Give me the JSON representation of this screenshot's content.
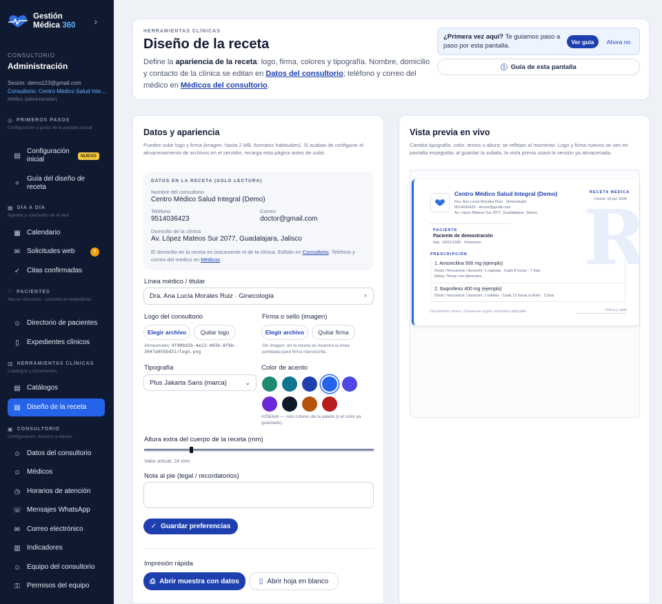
{
  "sidebar": {
    "brand_line1": "Gestión",
    "brand_line2a": "Médica",
    "brand_line2b": "360",
    "org_label": "CONSULTORIO",
    "org_name": "Administración",
    "session_label": "Sesión: demo123@gmail.com",
    "session_clinic": "Consultorio: Centro Médico Salud Integral",
    "session_role": "Médico (administrador)",
    "sections": [
      {
        "title": "PRIMEROS PASOS",
        "subtitle": "Configuración y guías de la pantalla actual"
      },
      {
        "title": "DÍA A DÍA",
        "subtitle": "Agenda y solicitudes de la web"
      },
      {
        "title": "PACIENTES",
        "subtitle": "Alta en directorio · consulta en expediente"
      },
      {
        "title": "HERRAMIENTAS CLÍNICAS",
        "subtitle": "Catálogos y documentos"
      },
      {
        "title": "CONSULTORIO",
        "subtitle": "Configuración, horarios y equipo"
      }
    ],
    "items": [
      {
        "label": "Configuración inicial",
        "badge": "NUEVO"
      },
      {
        "label": "Guía del diseño de receta"
      },
      {
        "label": "Calendario"
      },
      {
        "label": "Solicitudes web",
        "count": "7"
      },
      {
        "label": "Citas confirmadas"
      },
      {
        "label": "Directorio de pacientes"
      },
      {
        "label": "Expedientes clínicos"
      },
      {
        "label": "Catálogos"
      },
      {
        "label": "Diseño de la receta"
      },
      {
        "label": "Datos del consultorio"
      },
      {
        "label": "Médicos"
      },
      {
        "label": "Horarios de atención"
      },
      {
        "label": "Mensajes WhatsApp"
      },
      {
        "label": "Correo electrónico"
      },
      {
        "label": "Indicadores"
      },
      {
        "label": "Equipo del consultorio"
      },
      {
        "label": "Permisos del equipo"
      }
    ]
  },
  "header": {
    "eyebrow": "HERRAMIENTAS CLÍNICAS",
    "title": "Diseño de la receta",
    "lead_1": "Define la ",
    "lead_bold": "apariencia de la receta",
    "lead_2": ": logo, firma, colores y tipografía. Nombre, domicilio y contacto de la clínica se editan en ",
    "lead_link1": "Datos del consultorio",
    "lead_3": "; teléfono y correo del médico en ",
    "lead_link2": "Médicos del consultorio",
    "lead_4": ".",
    "tour_bold": "¿Primera vez aquí?",
    "tour_text": " Te guiamos paso a paso por esta pantalla.",
    "tour_primary": "Ver guía",
    "tour_secondary": "Ahora no",
    "guide_button": "Guía de esta pantalla"
  },
  "form": {
    "title": "Datos y apariencia",
    "intro": "Puedes subir logo y firma (imagen, hasta 2 MB, formatos habituales). Si acabas de configurar el almacenamiento de archivos en el servidor, recarga esta página antes de subir.",
    "readonly": {
      "eyebrow": "DATOS EN LA RECETA (SOLO LECTURA)",
      "name_label": "Nombre del consultorio",
      "name_value": "Centro Médico Salud Integral (Demo)",
      "phone_label": "Teléfono",
      "phone_value": "9514036423",
      "email_label": "Correo",
      "email_value": "doctor@gmail.com",
      "address_label": "Domicilio de la clínica",
      "address_value": "Av. López Mateos Sur 2077, Guadalajara, Jalisco",
      "note_1": "El domicilio en la receta es únicamente el de la clínica. Edítalo en ",
      "note_link1": "Consultorio",
      "note_2": ". Teléfono y correo del médico en ",
      "note_link2": "Médicos",
      "note_3": "."
    },
    "doctor_label": "Línea médico / titular",
    "doctor_value": "Dra. Ana Lucía Morales Ruiz · Ginecología",
    "logo_label": "Logo del consultorio",
    "logo_choose": "Elegir archivo",
    "logo_remove": "Quitar logo",
    "logo_stored_label": "Almacenado:",
    "logo_stored_path": "4f90bd1b-4e22-403b-8fbb-3947a955bd31/logo.png",
    "sign_label": "Firma o sello (imagen)",
    "sign_choose": "Elegir archivo",
    "sign_remove": "Quitar firma",
    "sign_note": "Sin imagen: en la receta se muestra la línea punteada para firma manuscrita.",
    "font_label": "Tipografía",
    "font_value": "Plus Jakarta Sans (marca)",
    "color_label": "Color de acento",
    "colors": [
      "#1f8a70",
      "#0e7490",
      "#1e40af",
      "#2563eb",
      "#4f46e5",
      "#6d28d9",
      "#0f172a",
      "#b45309",
      "#b91c1c"
    ],
    "selected_color_index": 3,
    "color_note": "#2563eb — solo colores de la paleta (o el color ya guardado).",
    "height_label": "Altura extra del cuerpo de la receta (mm)",
    "height_value": "Valor actual: 24 mm",
    "height_mm": 24,
    "footer_label": "Nota al pie (legal / recordatorios)",
    "footer_value": "",
    "save_button": "Guardar preferencias",
    "print_title": "Impresión rápida",
    "print_sample": "Abrir muestra con datos",
    "print_blank": "Abrir hoja en blanco"
  },
  "preview": {
    "title": "Vista previa en vivo",
    "intro": "Cambia tipografía, color, textos o altura: se reflejan al momento. Logo y firma nuevos se ven en pantalla enseguida; al guardar la subida, la vista previa usará la versión ya almacenada.",
    "clinic": "Centro Médico Salud Integral (Demo)",
    "doctor": "Dra. Ana Lucía Morales Ruiz · Ginecología",
    "contact": "9514036423 · doctor@gmail.com",
    "address": "Av. López Mateos Sur 2077, Guadalajara, Jalisco",
    "doc_type": "RECETA MÉDICA",
    "date": "Fecha: 16 jun 2026",
    "patient_eyebrow": "PACIENTE",
    "patient_name": "Paciente de demostración",
    "patient_meta": "Nac. 15/01/1990 · Femenino",
    "rx_eyebrow": "PRESCRIPCIÓN",
    "rx_big": "R",
    "rx_small": "x",
    "med1_name": "1. Amoxicilina 500 mg (ejemplo)",
    "med1_dose": "Dosis / frecuencia / duración: 1 cápsula · Cada 8 horas · 7 días",
    "med1_notes": "Notas: Tomar con alimentos.",
    "med2_name": "2. Ibuprofeno 400 mg (ejemplo)",
    "med2_dose": "Dosis / frecuencia / duración: 1 tableta · Cada 12 horas si dolor · 3 días",
    "footer_left": "Documento clínico. Conservar según normativa aplicable.",
    "footer_right": "Firma y sello"
  }
}
